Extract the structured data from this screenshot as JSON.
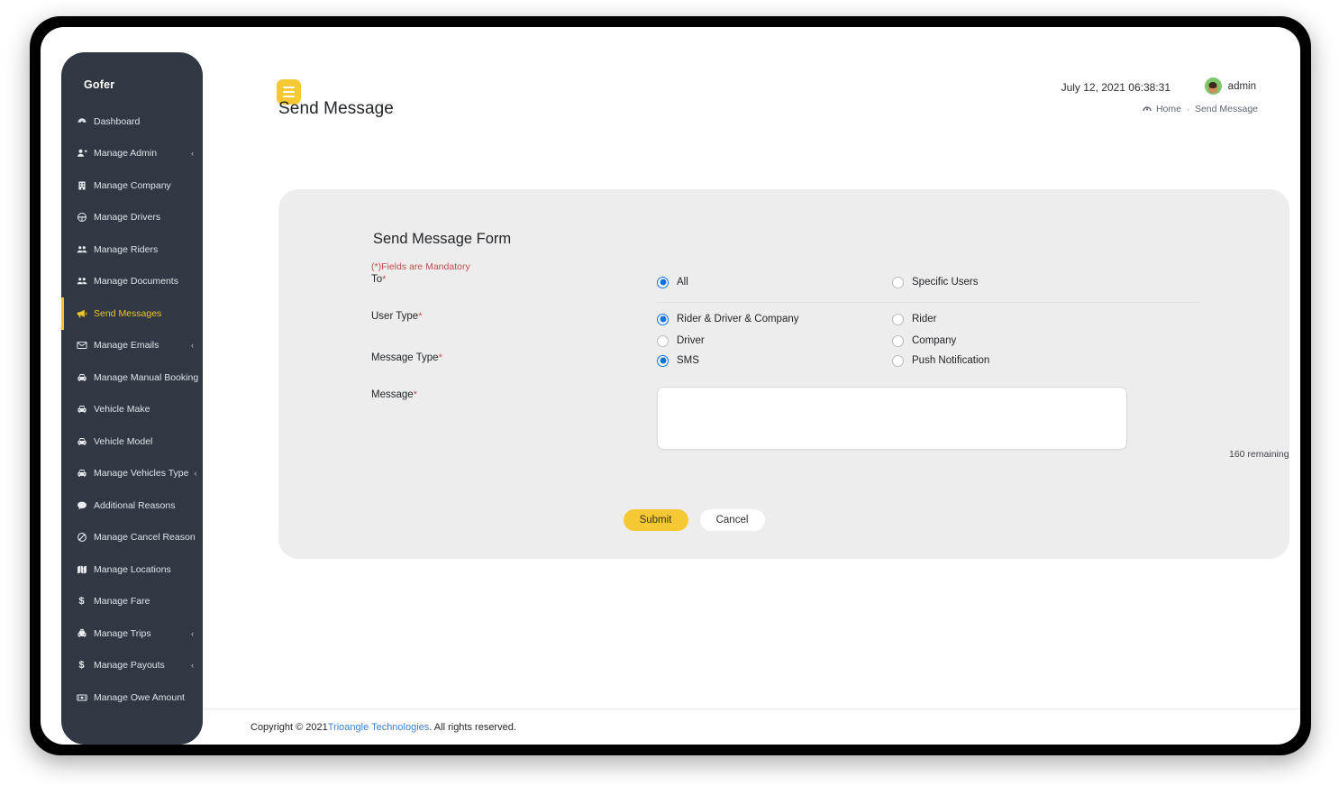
{
  "brand": {
    "name": "Gofer"
  },
  "sidebar": {
    "items": [
      {
        "label": "Dashboard",
        "icon": "dashboard-icon",
        "expandable": false
      },
      {
        "label": "Manage Admin",
        "icon": "user-plus-icon",
        "expandable": true
      },
      {
        "label": "Manage Company",
        "icon": "building-icon",
        "expandable": false
      },
      {
        "label": "Manage Drivers",
        "icon": "steering-wheel-icon",
        "expandable": false
      },
      {
        "label": "Manage Riders",
        "icon": "users-icon",
        "expandable": false
      },
      {
        "label": "Manage Documents",
        "icon": "users-icon",
        "expandable": false
      },
      {
        "label": "Send Messages",
        "icon": "megaphone-icon",
        "expandable": false,
        "active": true
      },
      {
        "label": "Manage Emails",
        "icon": "envelope-icon",
        "expandable": true
      },
      {
        "label": "Manage Manual Booking",
        "icon": "car-icon",
        "expandable": true
      },
      {
        "label": "Vehicle Make",
        "icon": "car-icon",
        "expandable": false
      },
      {
        "label": "Vehicle Model",
        "icon": "car-icon",
        "expandable": false
      },
      {
        "label": "Manage Vehicles Type",
        "icon": "car-icon",
        "expandable": true
      },
      {
        "label": "Additional Reasons",
        "icon": "comment-icon",
        "expandable": false
      },
      {
        "label": "Manage Cancel Reason",
        "icon": "ban-icon",
        "expandable": false
      },
      {
        "label": "Manage Locations",
        "icon": "map-icon",
        "expandable": false
      },
      {
        "label": "Manage Fare",
        "icon": "dollar-icon",
        "expandable": false
      },
      {
        "label": "Manage Trips",
        "icon": "taxi-icon",
        "expandable": true
      },
      {
        "label": "Manage Payouts",
        "icon": "dollar-icon",
        "expandable": true
      },
      {
        "label": "Manage Owe Amount",
        "icon": "money-bill-icon",
        "expandable": false
      }
    ],
    "chevron": "‹"
  },
  "topbar": {
    "menu_toggle": "hamburger-icon",
    "datetime": "July 12, 2021 06:38:31",
    "username": "admin"
  },
  "page": {
    "title": "Send Message",
    "breadcrumb": {
      "home": "Home",
      "separator": "›",
      "current": "Send Message"
    }
  },
  "form": {
    "title": "Send Message Form",
    "mandatory_note": "(*)Fields are Mandatory",
    "rows": [
      {
        "label": "To",
        "required": "*",
        "left_options": [
          {
            "label": "All",
            "selected": true
          }
        ],
        "right_options": [
          {
            "label": "Specific Users",
            "selected": false
          }
        ]
      },
      {
        "label": "User Type",
        "required": "*",
        "left_options": [
          {
            "label": "Rider & Driver & Company",
            "selected": true
          },
          {
            "label": "Driver",
            "selected": false
          }
        ],
        "right_options": [
          {
            "label": "Rider",
            "selected": false
          },
          {
            "label": "Company",
            "selected": false
          }
        ]
      },
      {
        "label": "Message Type",
        "required": "*",
        "left_options": [
          {
            "label": "SMS",
            "selected": true
          }
        ],
        "right_options": [
          {
            "label": "Push Notification",
            "selected": false
          }
        ]
      }
    ],
    "message": {
      "label": "Message",
      "required": "*",
      "value": "",
      "placeholder": "",
      "remaining": "160 remaining"
    },
    "submit_label": "Submit",
    "cancel_label": "Cancel"
  },
  "footer": {
    "prefix": "Copyright © 2021 ",
    "link": "Trioangle Technologies",
    "suffix": " . All rights reserved."
  }
}
